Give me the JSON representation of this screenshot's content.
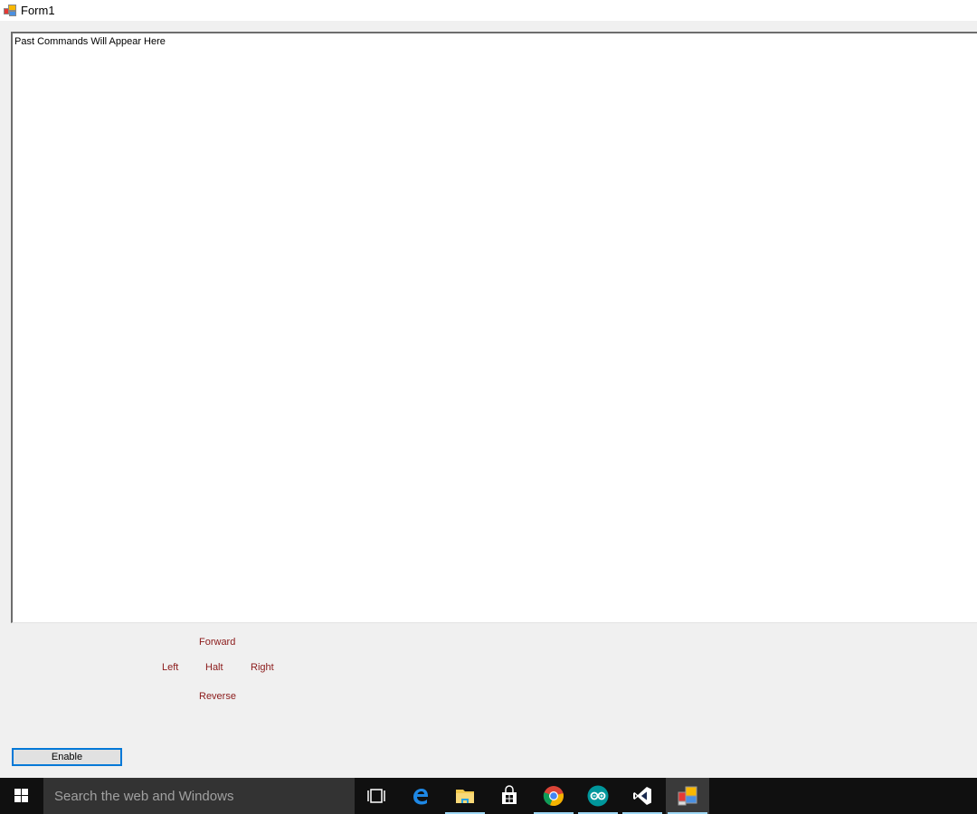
{
  "window": {
    "title": "Form1",
    "icon": "winforms-app-icon"
  },
  "history": {
    "text": "Past Commands Will Appear Here"
  },
  "commands": {
    "forward": "Forward",
    "left": "Left",
    "halt": "Halt",
    "right": "Right",
    "reverse": "Reverse",
    "color": "#8b1a1a"
  },
  "enable_button": {
    "label": "Enable",
    "focus_color": "#0078d7"
  },
  "taskbar": {
    "search_placeholder": "Search the web and Windows",
    "items": [
      {
        "name": "task-view-icon",
        "running": false,
        "active": false
      },
      {
        "name": "edge-icon",
        "running": false,
        "active": false
      },
      {
        "name": "file-explorer-icon",
        "running": true,
        "active": false
      },
      {
        "name": "store-icon",
        "running": false,
        "active": false
      },
      {
        "name": "chrome-icon",
        "running": true,
        "active": false
      },
      {
        "name": "arduino-icon",
        "running": true,
        "active": false
      },
      {
        "name": "visual-studio-icon",
        "running": true,
        "active": false
      },
      {
        "name": "form1-app-icon",
        "running": true,
        "active": true
      }
    ]
  }
}
